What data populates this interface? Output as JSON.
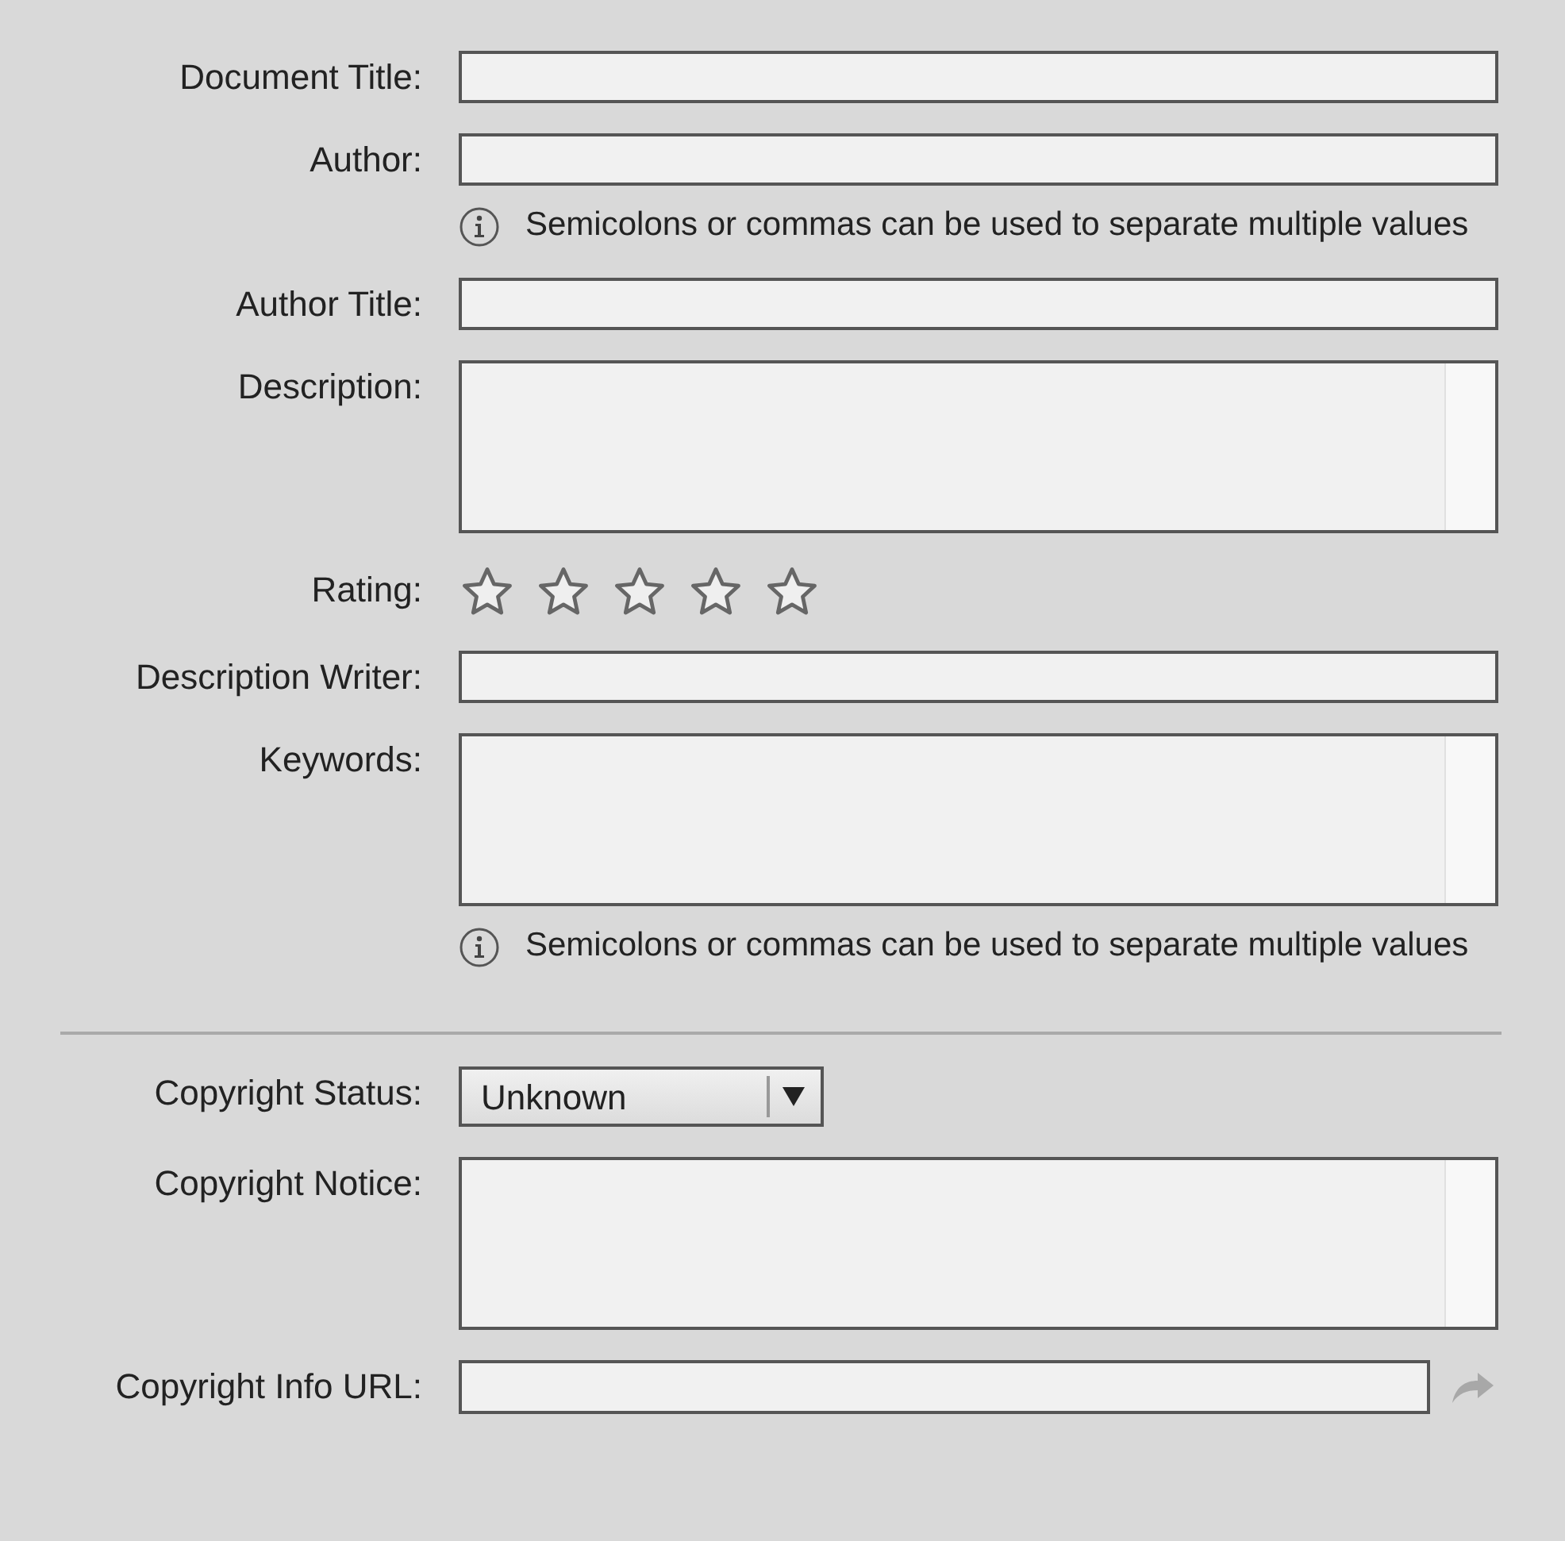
{
  "sections": [
    {
      "rows": [
        {
          "kind": "text",
          "label": "Document Title:"
        },
        {
          "kind": "text",
          "label": "Author:",
          "hint": "Semicolons or commas can be used to separate multiple values"
        },
        {
          "kind": "text",
          "label": "Author Title:"
        },
        {
          "kind": "textarea",
          "label": "Description:"
        },
        {
          "kind": "rating",
          "label": "Rating:",
          "stars": 0
        },
        {
          "kind": "text",
          "label": "Description Writer:"
        },
        {
          "kind": "textarea",
          "label": "Keywords:",
          "hint": "Semicolons or commas can be used to separate multiple values"
        }
      ]
    },
    {
      "rows": [
        {
          "kind": "select",
          "label": "Copyright Status:",
          "value": "Unknown"
        },
        {
          "kind": "textarea",
          "label": "Copyright Notice:"
        },
        {
          "kind": "url",
          "label": "Copyright Info URL:"
        }
      ]
    }
  ]
}
